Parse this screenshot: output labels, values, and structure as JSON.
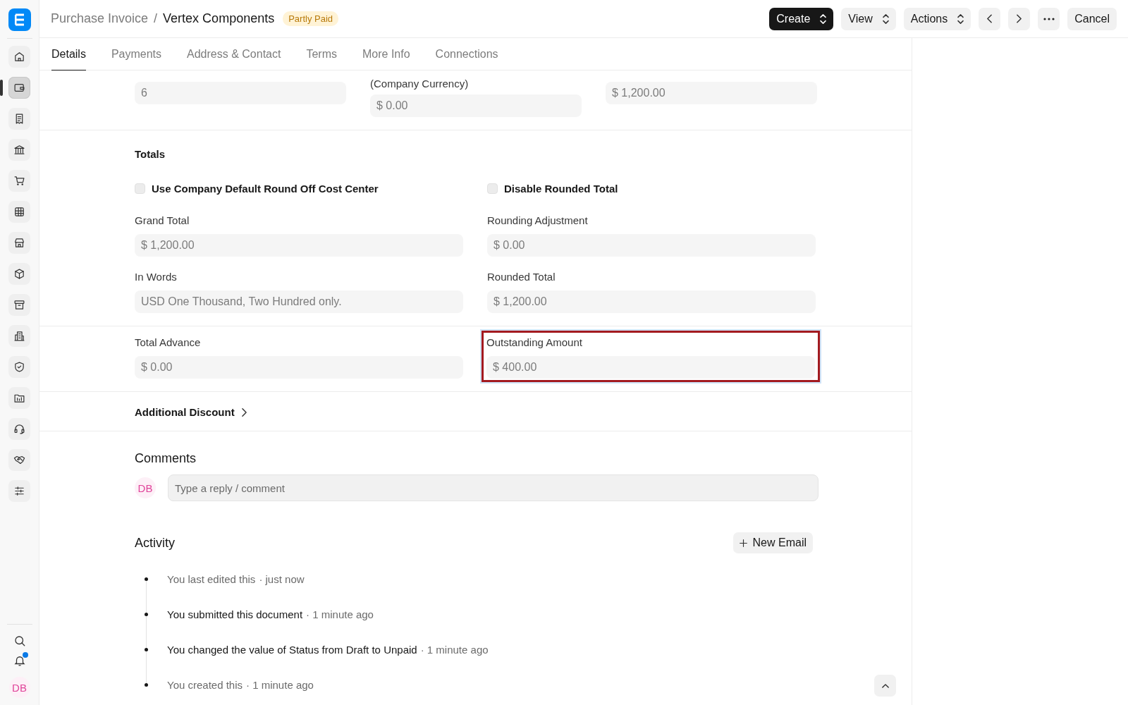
{
  "sidebar": {
    "items": [
      {
        "selected": false
      },
      {
        "selected": true
      },
      {
        "selected": false
      },
      {
        "selected": false
      },
      {
        "selected": false
      },
      {
        "selected": false
      },
      {
        "selected": false
      },
      {
        "selected": false
      },
      {
        "selected": false
      },
      {
        "selected": false
      },
      {
        "selected": false
      },
      {
        "selected": false
      },
      {
        "selected": false
      },
      {
        "selected": false
      },
      {
        "selected": false
      }
    ],
    "avatar": "DB",
    "notification": true
  },
  "header": {
    "breadcrumb": "Purchase Invoice",
    "separator": "/",
    "title": "Vertex Components",
    "status": "Partly Paid",
    "buttons": [
      {
        "kind": "primary",
        "label": "Create"
      },
      {
        "kind": "dropdown",
        "label": "View"
      },
      {
        "kind": "dropdown",
        "label": "Actions"
      },
      {
        "kind": "prev"
      },
      {
        "kind": "next"
      },
      {
        "kind": "more"
      },
      {
        "kind": "plain",
        "label": "Cancel"
      }
    ]
  },
  "tabs": [
    {
      "label": "Details",
      "selected": true
    },
    {
      "label": "Payments",
      "selected": false
    },
    {
      "label": "Address & Contact",
      "selected": false
    },
    {
      "label": "Terms",
      "selected": false
    },
    {
      "label": "More Info",
      "selected": false
    },
    {
      "label": "Connections",
      "selected": false
    }
  ],
  "top_fields": [
    {
      "value": "6"
    },
    {
      "label": "(Company Currency)",
      "value": "$ 0.00"
    },
    {
      "value": "$ 1,200.00"
    }
  ],
  "totals": {
    "title": "Totals",
    "checkboxes": [
      {
        "label": "Use Company Default Round Off Cost Center",
        "checked": false
      },
      {
        "label": "Disable Rounded Total",
        "checked": false
      }
    ],
    "fields": [
      {
        "label": "Grand Total",
        "value": "$ 1,200.00"
      },
      {
        "label": "Rounding Adjustment",
        "value": "$ 0.00"
      },
      {
        "label": "In Words",
        "value": "USD One Thousand, Two Hundred only."
      },
      {
        "label": "Rounded Total",
        "value": "$ 1,200.00"
      }
    ]
  },
  "advance_fields": [
    {
      "label": "Total Advance",
      "value": "$ 0.00",
      "highlighted": false
    },
    {
      "label": "Outstanding Amount",
      "value": "$ 400.00",
      "highlighted": true
    }
  ],
  "additional_discount": {
    "label": "Additional Discount",
    "expanded": false
  },
  "comments": {
    "title": "Comments",
    "avatar": "DB",
    "placeholder": "Type a reply / comment"
  },
  "activity": {
    "title": "Activity",
    "new_email": "New Email",
    "items": [
      {
        "text": "You last edited this",
        "emphasis": false,
        "time": "· just now"
      },
      {
        "text": "You submitted this document",
        "emphasis": true,
        "time": "· 1 minute ago"
      },
      {
        "text": "You changed the value of Status from Draft to Unpaid",
        "emphasis": true,
        "time": "· 1 minute ago"
      },
      {
        "text": "You created this",
        "emphasis": false,
        "time": "· 1 minute ago"
      }
    ]
  }
}
